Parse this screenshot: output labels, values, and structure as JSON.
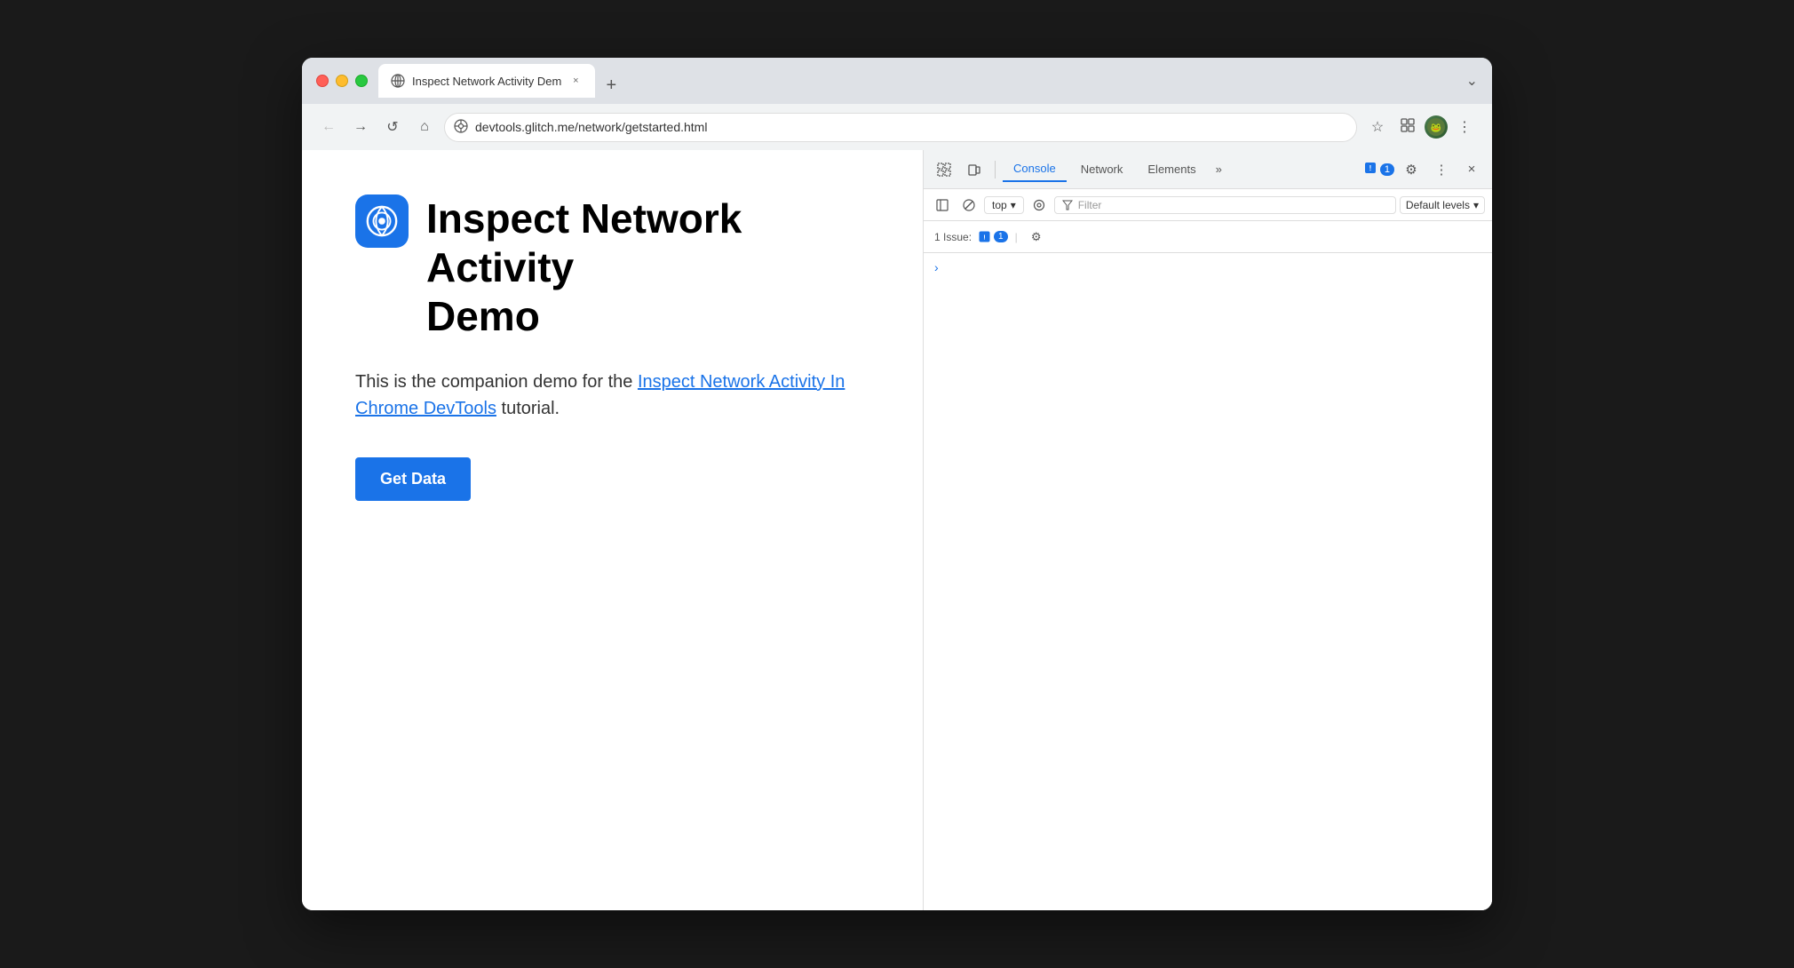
{
  "browser": {
    "tab": {
      "favicon_alt": "globe",
      "title": "Inspect Network Activity Dem",
      "close_label": "×",
      "new_tab_label": "+"
    },
    "chevron": "⌄",
    "nav": {
      "back_label": "←",
      "forward_label": "→",
      "reload_label": "↺",
      "home_label": "⌂"
    },
    "address": {
      "icon_label": "⊙",
      "url": "devtools.glitch.me/network/getstarted.html"
    },
    "toolbar_right": {
      "bookmark_label": "☆",
      "extensions_label": "🧩",
      "menu_label": "⋮"
    }
  },
  "webpage": {
    "logo_alt": "Glitch logo",
    "title_line1": "Inspect Network Activity",
    "title_line2": "Demo",
    "description_prefix": "This is the companion demo for the",
    "link_text": "Inspect Network Activity In Chrome DevTools",
    "description_suffix": "tutorial.",
    "button_label": "Get Data"
  },
  "devtools": {
    "tabs": [
      {
        "label": "Console",
        "active": true
      },
      {
        "label": "Network",
        "active": false
      },
      {
        "label": "Elements",
        "active": false
      }
    ],
    "more_label": "»",
    "badge_count": "1",
    "icons": {
      "inspect_label": "⊡",
      "device_label": "⬜",
      "settings_label": "⚙",
      "more_menu_label": "⋮",
      "close_label": "×",
      "sidebar_label": "⊞",
      "clear_label": "⊘",
      "eye_label": "◉",
      "filter_label": "⊿",
      "chevron_down": "▾"
    },
    "console_toolbar": {
      "top_label": "top",
      "filter_placeholder": "Filter",
      "levels_label": "Default levels",
      "levels_arrow": "▾"
    },
    "issues_bar": {
      "label": "1 Issue:",
      "count": "1",
      "gear_label": "⚙"
    },
    "console_chevron": "›"
  }
}
